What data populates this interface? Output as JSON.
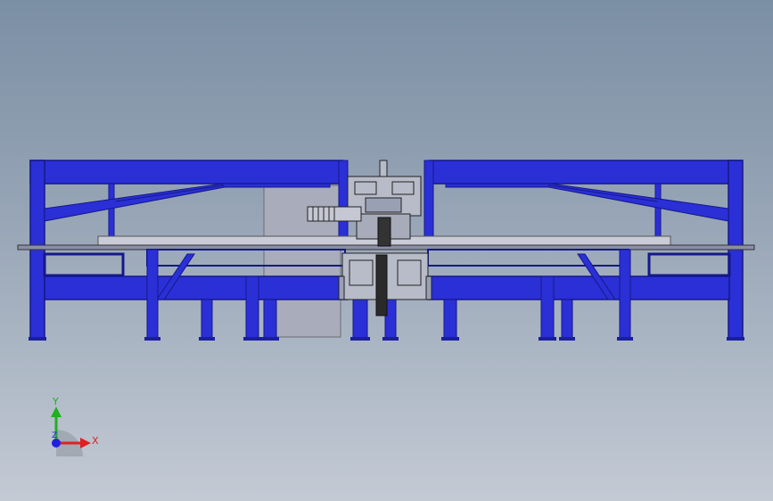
{
  "viewport": {
    "colors": {
      "frame": "#2b2fd6",
      "frame_dark": "#1a1f9e",
      "frame_light": "#4a50f0",
      "table": "#c9ccd6",
      "machine_line": "#222222",
      "axis_x": "#e02020",
      "axis_y": "#20b020",
      "axis_z": "#2020e0"
    }
  },
  "triad": {
    "x_label": "X",
    "y_label": "Y",
    "z_label": "Z"
  }
}
